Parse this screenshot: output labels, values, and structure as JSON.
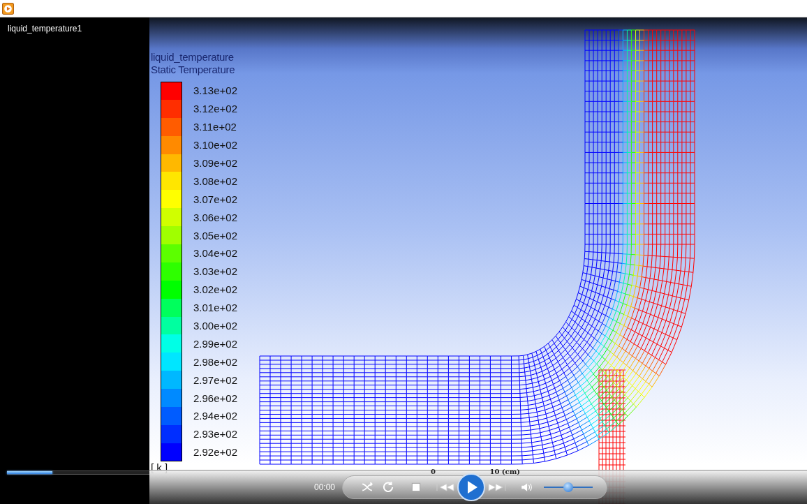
{
  "playlist": {
    "item": "liquid_temperature1"
  },
  "seek": {
    "level": 0.32
  },
  "video": {
    "legend": {
      "title": "liquid_temperature",
      "subtitle": "Static Temperature",
      "unit": "[ k ]",
      "entries": [
        {
          "label": "3.13e+02",
          "color": "#ff0000"
        },
        {
          "label": "3.12e+02",
          "color": "#ff2e00"
        },
        {
          "label": "3.11e+02",
          "color": "#ff5c00"
        },
        {
          "label": "3.10e+02",
          "color": "#ff8a00"
        },
        {
          "label": "3.09e+02",
          "color": "#ffb800"
        },
        {
          "label": "3.08e+02",
          "color": "#ffe600"
        },
        {
          "label": "3.07e+02",
          "color": "#ffff00"
        },
        {
          "label": "3.06e+02",
          "color": "#d0ff00"
        },
        {
          "label": "3.05e+02",
          "color": "#a0ff00"
        },
        {
          "label": "3.04e+02",
          "color": "#5cff00"
        },
        {
          "label": "3.03e+02",
          "color": "#2eff00"
        },
        {
          "label": "3.02e+02",
          "color": "#00ff00"
        },
        {
          "label": "3.01e+02",
          "color": "#00ff5c"
        },
        {
          "label": "3.00e+02",
          "color": "#00ffa0"
        },
        {
          "label": "2.99e+02",
          "color": "#00ffe6"
        },
        {
          "label": "2.98e+02",
          "color": "#00e6ff"
        },
        {
          "label": "2.97e+02",
          "color": "#00b8ff"
        },
        {
          "label": "2.96e+02",
          "color": "#008aff"
        },
        {
          "label": "2.94e+02",
          "color": "#005cff"
        },
        {
          "label": "2.93e+02",
          "color": "#002eff"
        },
        {
          "label": "2.92e+02",
          "color": "#0000ff"
        }
      ]
    },
    "scale": {
      "start": "0",
      "end": "10 (cm)"
    }
  },
  "controls": {
    "time": "00:00",
    "volume": {
      "level": 0.5
    }
  }
}
